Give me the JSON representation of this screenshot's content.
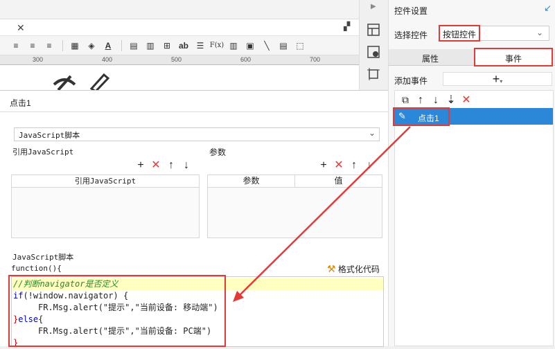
{
  "editor": {
    "ruler_ticks": [
      "300",
      "400",
      "500",
      "600",
      "700"
    ],
    "toolbar_text": [
      "ab",
      "F(x)"
    ]
  },
  "right_panel": {
    "title": "控件设置",
    "select_widget_label": "选择控件",
    "select_widget_value": "按钮控件",
    "tab_props": "属性",
    "tab_events": "事件",
    "add_event_label": "添加事件",
    "add_event_button": "+",
    "event_item": "点击1"
  },
  "dialog": {
    "title": "点击1",
    "type_select": "JavaScript脚本",
    "ref_js_label": "引用JavaScript",
    "param_label": "参数",
    "ref_js_col": "引用JavaScript",
    "param_col": "参数",
    "value_col": "值",
    "script_label": "JavaScript脚本",
    "fn_header": "function(){",
    "format_button": "格式化代码",
    "code": {
      "line1": "//判断navigator是否定义",
      "line2_kw": "if",
      "line2_rest": "(!window.navigator) {",
      "line3": "FR.Msg.alert(\"提示\",\"当前设备: 移动端\")",
      "line4_a": "}",
      "line4_kw": "else",
      "line4_b": "{",
      "line5": "FR.Msg.alert(\"提示\",\"当前设备: PC端\")",
      "line6": "}"
    }
  },
  "colors": {
    "accent": "#e53935",
    "selection": "#2b88d8",
    "highlight_line": "#ffffc0"
  }
}
